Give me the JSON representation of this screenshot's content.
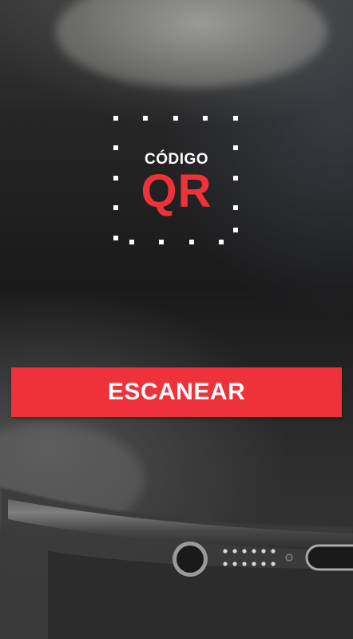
{
  "logo": {
    "top_text": "CÓDIGO",
    "main_text": "QR",
    "frame_icon": "qr-scan-frame-icon"
  },
  "actions": {
    "scan_label": "ESCANEAR"
  },
  "colors": {
    "accent": "#ef3239",
    "text_light": "#ffffff",
    "background": "#1b1b1c"
  },
  "background_image": "blurred-phone-photo"
}
